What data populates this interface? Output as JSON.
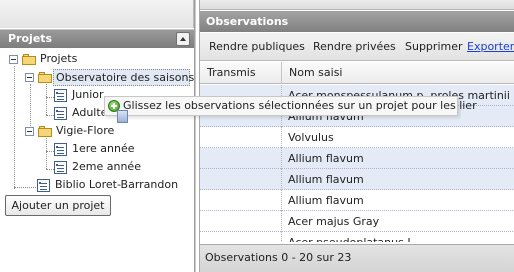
{
  "left_panel": {
    "title": "Projets",
    "tree": [
      {
        "label": "Projets",
        "icon": "folder-open-icon",
        "expanded": true
      },
      {
        "label": "Observatoire des saisons",
        "icon": "folder-open-icon",
        "expanded": true,
        "selected": true
      },
      {
        "label": "Junior",
        "icon": "project-doc-icon"
      },
      {
        "label": "Adulte",
        "icon": "project-doc-icon"
      },
      {
        "label": "Vigie-Flore",
        "icon": "folder-open-icon",
        "expanded": true
      },
      {
        "label": "1ere année",
        "icon": "project-doc-icon"
      },
      {
        "label": "2eme année",
        "icon": "project-doc-icon"
      },
      {
        "label": "Biblio Loret-Barrandon",
        "icon": "project-doc-icon"
      }
    ],
    "add_button": "Ajouter un projet"
  },
  "observations": {
    "title": "Observations",
    "toolbar": {
      "publish": "Rendre publiques",
      "private": "Rendre privées",
      "delete": "Supprimer",
      "export": "Exporter"
    },
    "columns": {
      "transmis": "Transmis",
      "nom": "Nom saisi"
    },
    "rows": [
      {
        "nom": "Acer monspessulanum p. proles martinii (Jor"
      },
      {
        "nom": "Allium flavum"
      },
      {
        "nom": "Volvulus"
      },
      {
        "nom": "Allium flavum"
      },
      {
        "nom": "Allium flavum"
      },
      {
        "nom": "Allium flavum"
      },
      {
        "nom": "Acer majus Gray"
      },
      {
        "nom": "Acer pseudoplatanus L."
      }
    ],
    "status": "Observations 0 - 20 sur 23"
  },
  "drag_tooltip": {
    "text": "Glissez les observations sélectionnées sur un projet pour les lier",
    "icon": "drop-allowed-icon"
  },
  "colors": {
    "header_gray": "#8f8f8f",
    "selected_row": "#e4ebf6",
    "link": "#1a3fd6",
    "drop_ok": "#3e9a22"
  }
}
